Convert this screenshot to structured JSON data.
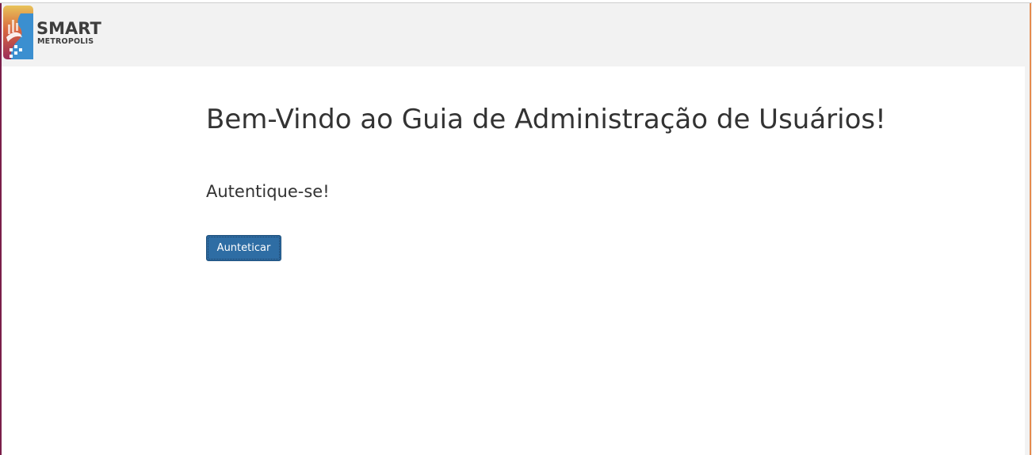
{
  "header": {
    "logo": {
      "name": "smart-metropolis-logo",
      "line1": "SMART",
      "line2": "METROPOLIS"
    }
  },
  "main": {
    "title": "Bem-Vindo ao Guia de Administração de Usuários!",
    "subtitle": "Autentique-se!",
    "auth_button_label": "Aunteticar"
  },
  "colors": {
    "header_bg": "#f2f2f2",
    "button_bg": "#2e6da4",
    "text": "#333333"
  }
}
